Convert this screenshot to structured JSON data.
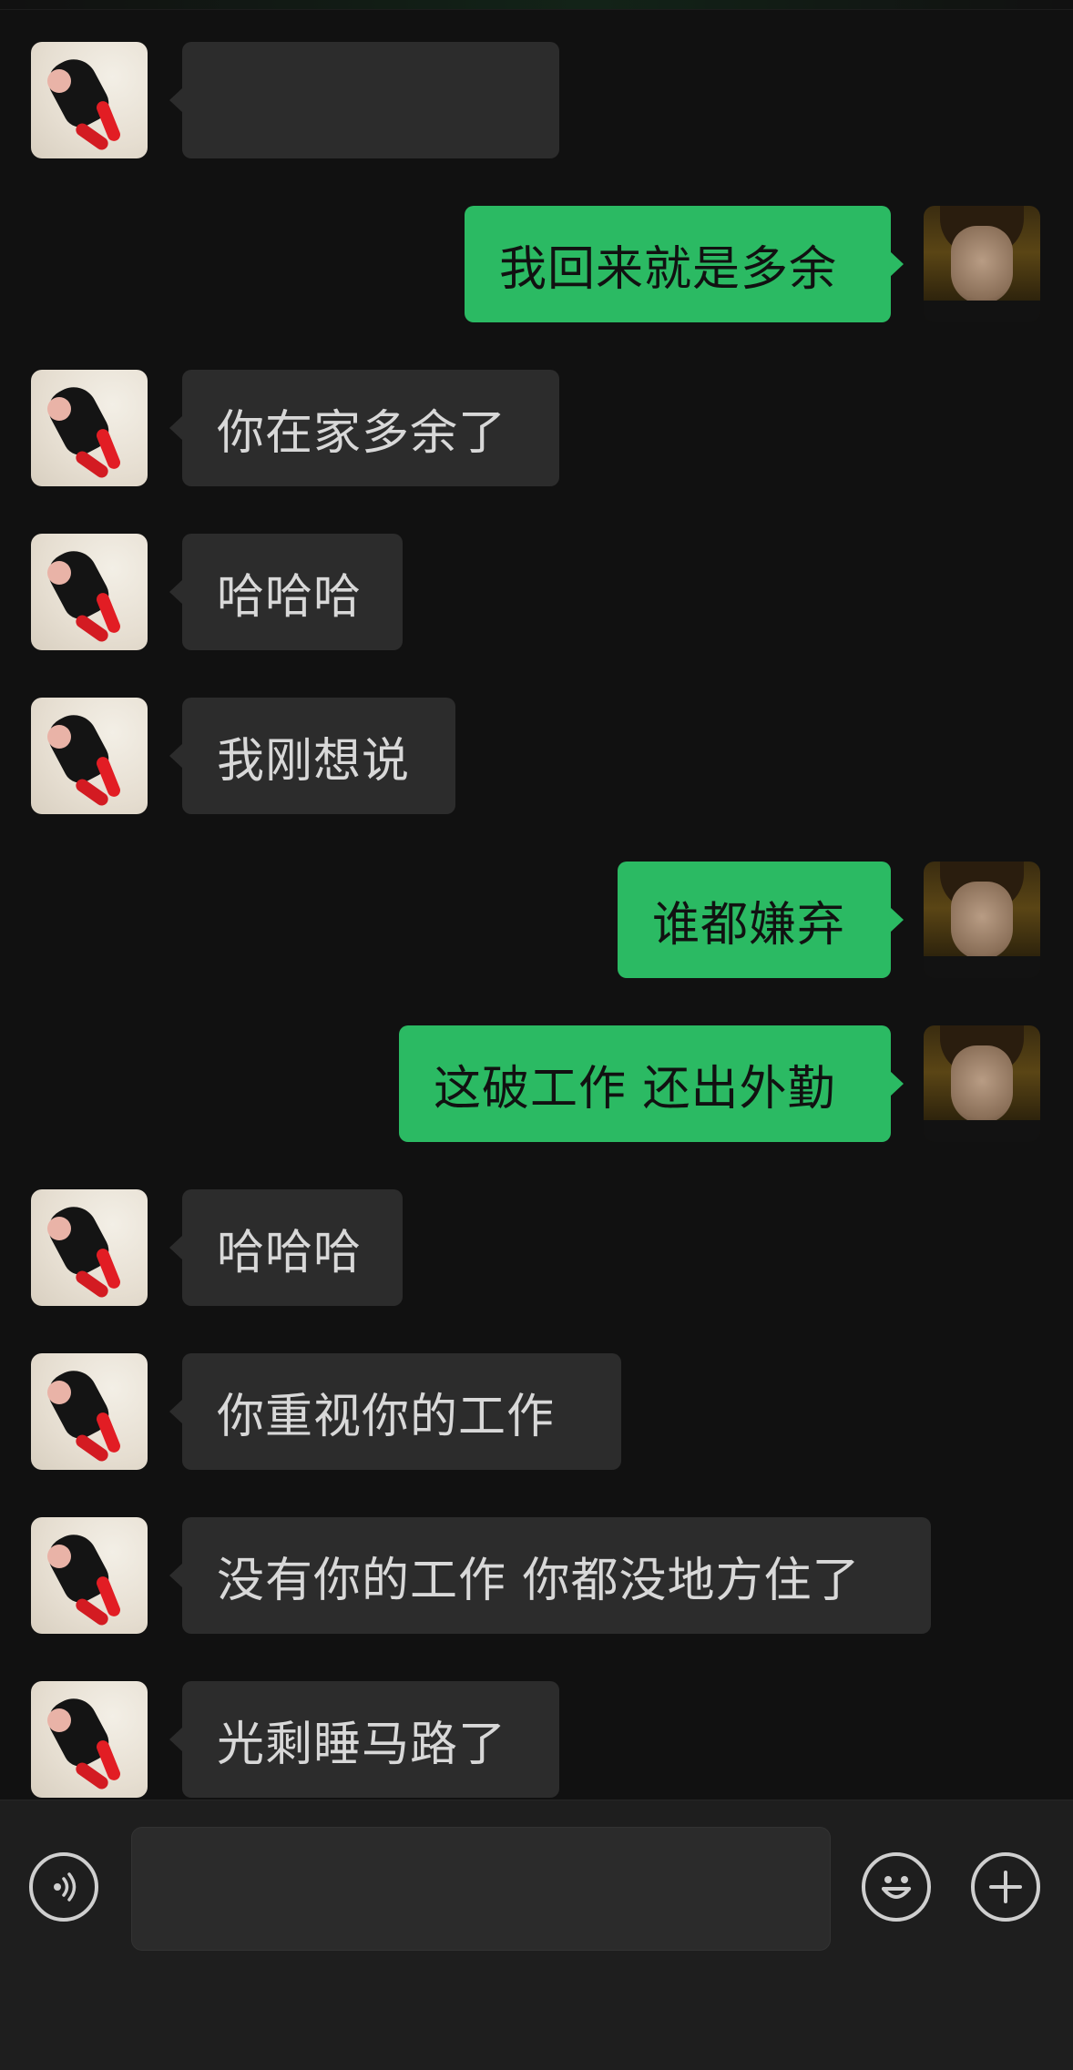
{
  "composer": {
    "voice_icon": "voice-input-icon",
    "emoji_icon": "emoji-icon",
    "plus_icon": "plus-icon",
    "input_value": "",
    "input_placeholder": ""
  },
  "messages": [
    {
      "side": "left",
      "text": "",
      "blurred": true
    },
    {
      "side": "right",
      "text": "我回来就是多余"
    },
    {
      "side": "left",
      "text": "你在家多余了"
    },
    {
      "side": "left",
      "text": "哈哈哈"
    },
    {
      "side": "left",
      "text": "我刚想说"
    },
    {
      "side": "right",
      "text": "谁都嫌弃"
    },
    {
      "side": "right",
      "text": "这破工作 还出外勤"
    },
    {
      "side": "left",
      "text": "哈哈哈"
    },
    {
      "side": "left",
      "text": "你重视你的工作"
    },
    {
      "side": "left",
      "text": "没有你的工作 你都没地方住了"
    },
    {
      "side": "left",
      "text": "光剩睡马路了"
    }
  ],
  "colors": {
    "background": "#111111",
    "incoming_bubble": "#2c2c2c",
    "outgoing_bubble": "#2bba63",
    "incoming_text": "#d8d8d8",
    "outgoing_text": "#111111"
  }
}
